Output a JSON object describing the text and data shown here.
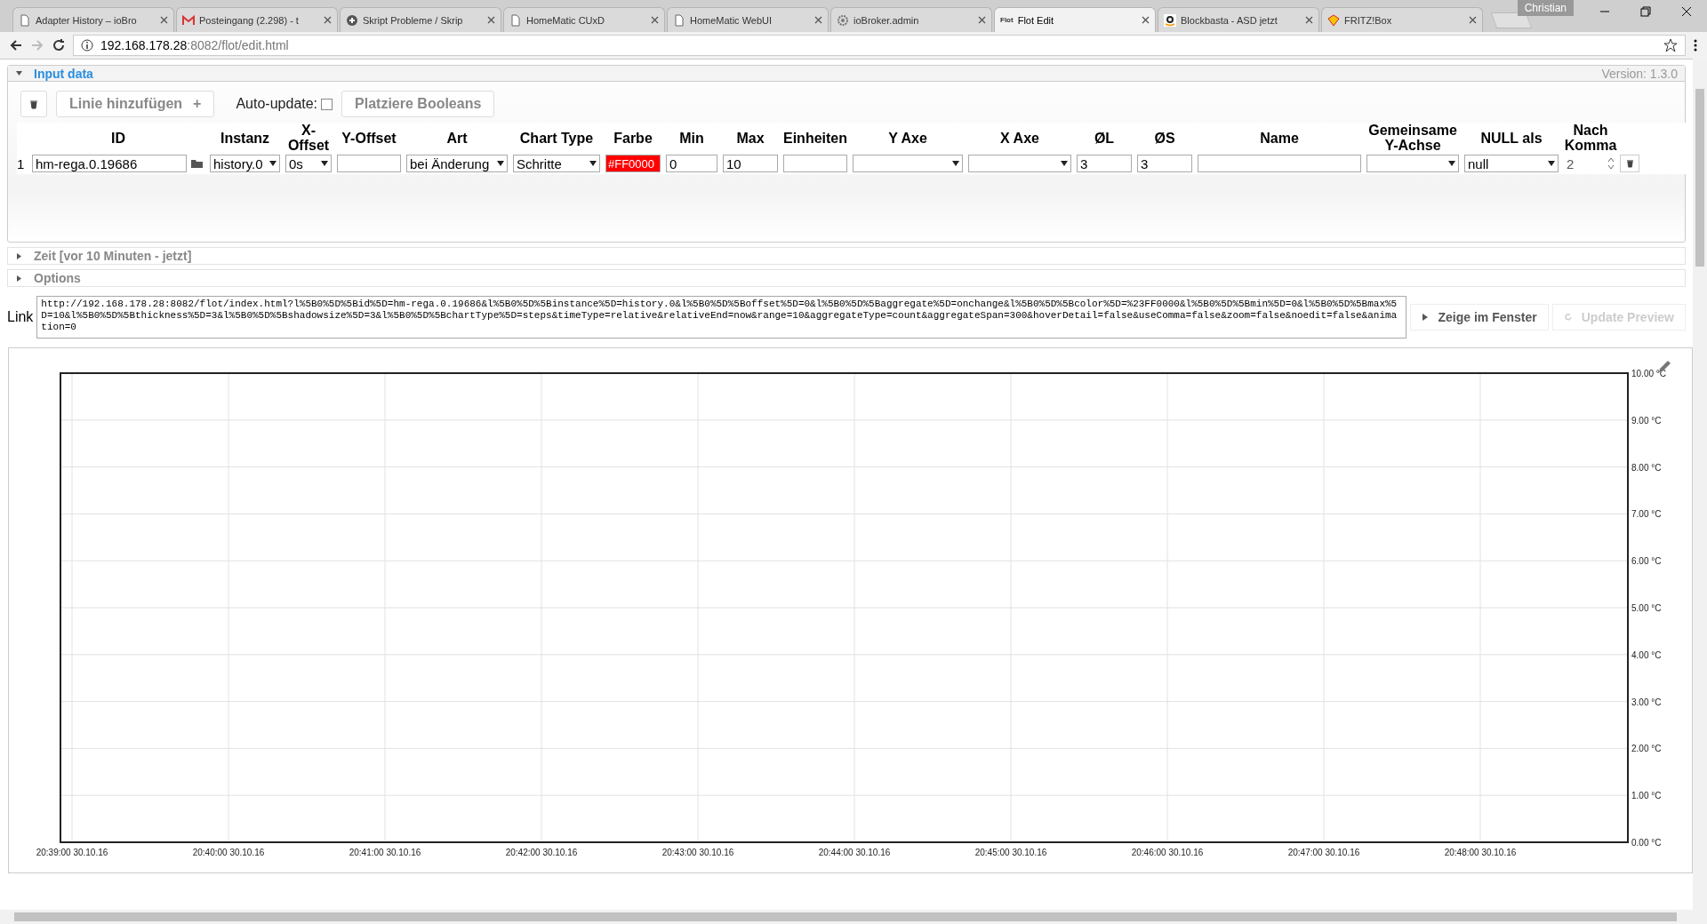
{
  "browser": {
    "tabs": [
      {
        "title": "Adapter History – ioBro",
        "kind": "page",
        "selected": false
      },
      {
        "title": "Posteingang (2.298) - t",
        "kind": "mail",
        "selected": false
      },
      {
        "title": "Skript Probleme / Skrip",
        "kind": "plus",
        "selected": false
      },
      {
        "title": "HomeMatic CUxD",
        "kind": "page",
        "selected": false
      },
      {
        "title": "HomeMatic WebUI",
        "kind": "page",
        "selected": false
      },
      {
        "title": "ioBroker.admin",
        "kind": "gear",
        "selected": false
      },
      {
        "title": "Flot Edit",
        "kind": "text",
        "icon_text": "Flot",
        "selected": true
      },
      {
        "title": "Blockbasta - ASD jetzt",
        "kind": "amazon",
        "selected": false
      },
      {
        "title": "FRITZ!Box",
        "kind": "fritz",
        "selected": false
      }
    ],
    "user": "Christian",
    "url_host": "192.168.178.28",
    "url_path": ":8082/flot/edit.html"
  },
  "input_data": {
    "title": "Input data",
    "expanded": true,
    "version": "Version: 1.3.0",
    "add_line_button": "Linie hinzufügen",
    "add_icon": "+",
    "auto_update": {
      "label": "Auto-update:",
      "checked": false
    },
    "booleans_button": "Platziere Booleans",
    "columns": [
      "ID",
      "Instanz",
      "X-Offset",
      "Y-Offset",
      "Art",
      "Chart Type",
      "Farbe",
      "Min",
      "Max",
      "Einheiten",
      "Y Axe",
      "X Axe",
      "ØL",
      "ØS",
      "Name",
      "Gemeinsame Y-Achse",
      "NULL als",
      "Nach Komma"
    ],
    "rows": [
      {
        "number": "1",
        "cells": [
          {
            "kind": "id",
            "value": "hm-rega.0.19686"
          },
          {
            "kind": "select",
            "value": "history.0"
          },
          {
            "kind": "select",
            "value": "0s"
          },
          {
            "kind": "input"
          },
          {
            "kind": "select",
            "value": "bei Änderung"
          },
          {
            "kind": "select",
            "value": "Schritte"
          },
          {
            "kind": "color",
            "value": "#FF0000"
          },
          {
            "kind": "input",
            "value": "0"
          },
          {
            "kind": "input",
            "value": "10"
          },
          {
            "kind": "input"
          },
          {
            "kind": "select"
          },
          {
            "kind": "select"
          },
          {
            "kind": "input",
            "value": "3"
          },
          {
            "kind": "input",
            "value": "3"
          },
          {
            "kind": "input"
          },
          {
            "kind": "select"
          },
          {
            "kind": "select",
            "value": "null"
          },
          {
            "kind": "spin",
            "value": "2"
          }
        ]
      }
    ]
  },
  "sections": [
    {
      "title": "Zeit [vor 10 Minuten - jetzt]",
      "expanded": false
    },
    {
      "title": "Options",
      "expanded": false
    }
  ],
  "link": {
    "label": "Link",
    "value": "http://192.168.178.28:8082/flot/index.html?l%5B0%5D%5Bid%5D=hm-rega.0.19686&l%5B0%5D%5Binstance%5D=history.0&l%5B0%5D%5Boffset%5D=0&l%5B0%5D%5Baggregate%5D=onchange&l%5B0%5D%5Bcolor%5D=%23FF0000&l%5B0%5D%5Bmin%5D=0&l%5B0%5D%5Bmax%5D=10&l%5B0%5D%5Bthickness%5D=3&l%5B0%5D%5Bshadowsize%5D=3&l%5B0%5D%5BchartType%5D=steps&timeType=relative&relativeEnd=now&range=10&aggregateType=count&aggregateSpan=300&hoverDetail=false&useComma=false&zoom=false&noedit=false&animation=0",
    "show_button": "Zeige im Fenster",
    "update_button": {
      "label": "Update Preview",
      "disabled": true
    }
  },
  "preview": {
    "chart_data": {
      "type": "line",
      "grid": true,
      "ylim": [
        0,
        10
      ],
      "yticks": [
        {
          "value": 0,
          "label": "0.00 °C"
        },
        {
          "value": 1,
          "label": "1.00 °C"
        },
        {
          "value": 2,
          "label": "2.00 °C"
        },
        {
          "value": 3,
          "label": "3.00 °C"
        },
        {
          "value": 4,
          "label": "4.00 °C"
        },
        {
          "value": 5,
          "label": "5.00 °C"
        },
        {
          "value": 6,
          "label": "6.00 °C"
        },
        {
          "value": 7,
          "label": "7.00 °C"
        },
        {
          "value": 8,
          "label": "8.00 °C"
        },
        {
          "value": 9,
          "label": "9.00 °C"
        },
        {
          "value": 10,
          "label": "10.00 °C"
        }
      ],
      "categories": [
        "20:39:00 30.10.16",
        "20:40:00 30.10.16",
        "20:41:00 30.10.16",
        "20:42:00 30.10.16",
        "20:43:00 30.10.16",
        "20:44:00 30.10.16",
        "20:45:00 30.10.16",
        "20:46:00 30.10.16",
        "20:47:00 30.10.16",
        "20:48:00 30.10.16"
      ]
    }
  }
}
